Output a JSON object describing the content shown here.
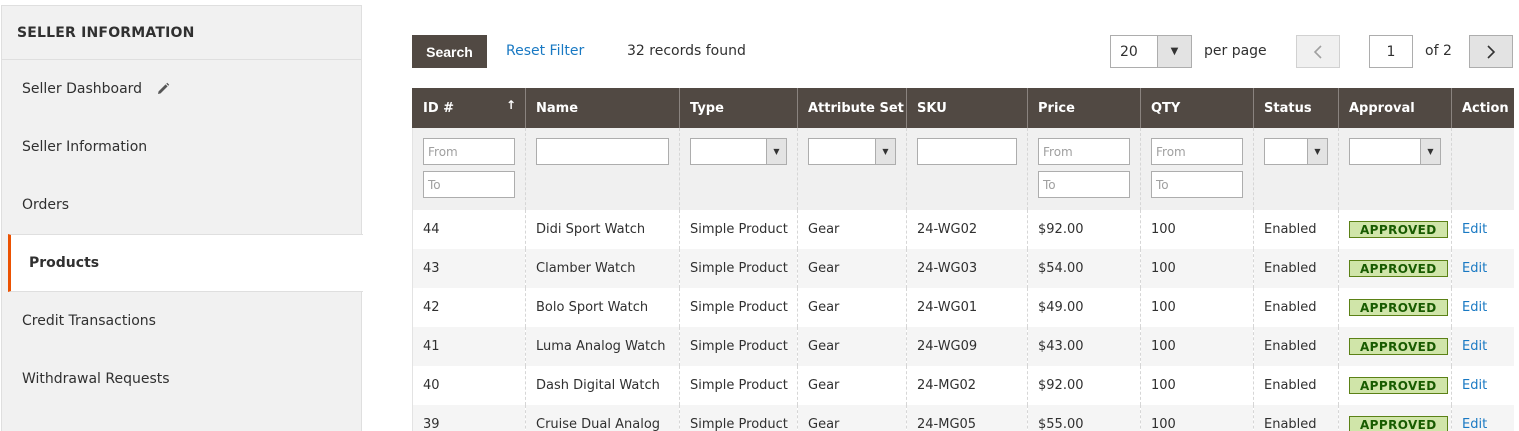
{
  "sidebar": {
    "title": "SELLER INFORMATION",
    "items": [
      {
        "label": "Seller Dashboard"
      },
      {
        "label": "Seller Information"
      },
      {
        "label": "Orders"
      },
      {
        "label": "Products"
      },
      {
        "label": "Credit Transactions"
      },
      {
        "label": "Withdrawal Requests"
      }
    ]
  },
  "toolbar": {
    "search_label": "Search",
    "reset_label": "Reset Filter",
    "records_text": "32 records found",
    "per_page_value": "20",
    "per_page_label": "per page",
    "current_page": "1",
    "page_of": "of 2"
  },
  "grid": {
    "columns": [
      "ID #",
      "Name",
      "Type",
      "Attribute Set",
      "SKU",
      "Price",
      "QTY",
      "Status",
      "Approval",
      "Action"
    ],
    "sort_indicator": "↑",
    "filters": {
      "from_placeholder": "From",
      "to_placeholder": "To"
    },
    "rows": [
      {
        "id": "44",
        "name": "Didi Sport Watch",
        "type": "Simple Product",
        "attr": "Gear",
        "sku": "24-WG02",
        "price": "$92.00",
        "qty": "100",
        "status": "Enabled",
        "approval": "APPROVED",
        "action": "Edit"
      },
      {
        "id": "43",
        "name": "Clamber Watch",
        "type": "Simple Product",
        "attr": "Gear",
        "sku": "24-WG03",
        "price": "$54.00",
        "qty": "100",
        "status": "Enabled",
        "approval": "APPROVED",
        "action": "Edit"
      },
      {
        "id": "42",
        "name": "Bolo Sport Watch",
        "type": "Simple Product",
        "attr": "Gear",
        "sku": "24-WG01",
        "price": "$49.00",
        "qty": "100",
        "status": "Enabled",
        "approval": "APPROVED",
        "action": "Edit"
      },
      {
        "id": "41",
        "name": "Luma Analog Watch",
        "type": "Simple Product",
        "attr": "Gear",
        "sku": "24-WG09",
        "price": "$43.00",
        "qty": "100",
        "status": "Enabled",
        "approval": "APPROVED",
        "action": "Edit"
      },
      {
        "id": "40",
        "name": "Dash Digital Watch",
        "type": "Simple Product",
        "attr": "Gear",
        "sku": "24-MG02",
        "price": "$92.00",
        "qty": "100",
        "status": "Enabled",
        "approval": "APPROVED",
        "action": "Edit"
      },
      {
        "id": "39",
        "name": "Cruise Dual Analog",
        "type": "Simple Product",
        "attr": "Gear",
        "sku": "24-MG05",
        "price": "$55.00",
        "qty": "100",
        "status": "Enabled",
        "approval": "APPROVED",
        "action": "Edit"
      }
    ]
  },
  "colors": {
    "header_bg": "#514943",
    "accent": "#eb5202",
    "link": "#1979c3",
    "approved_bg": "#d0e5a9"
  }
}
